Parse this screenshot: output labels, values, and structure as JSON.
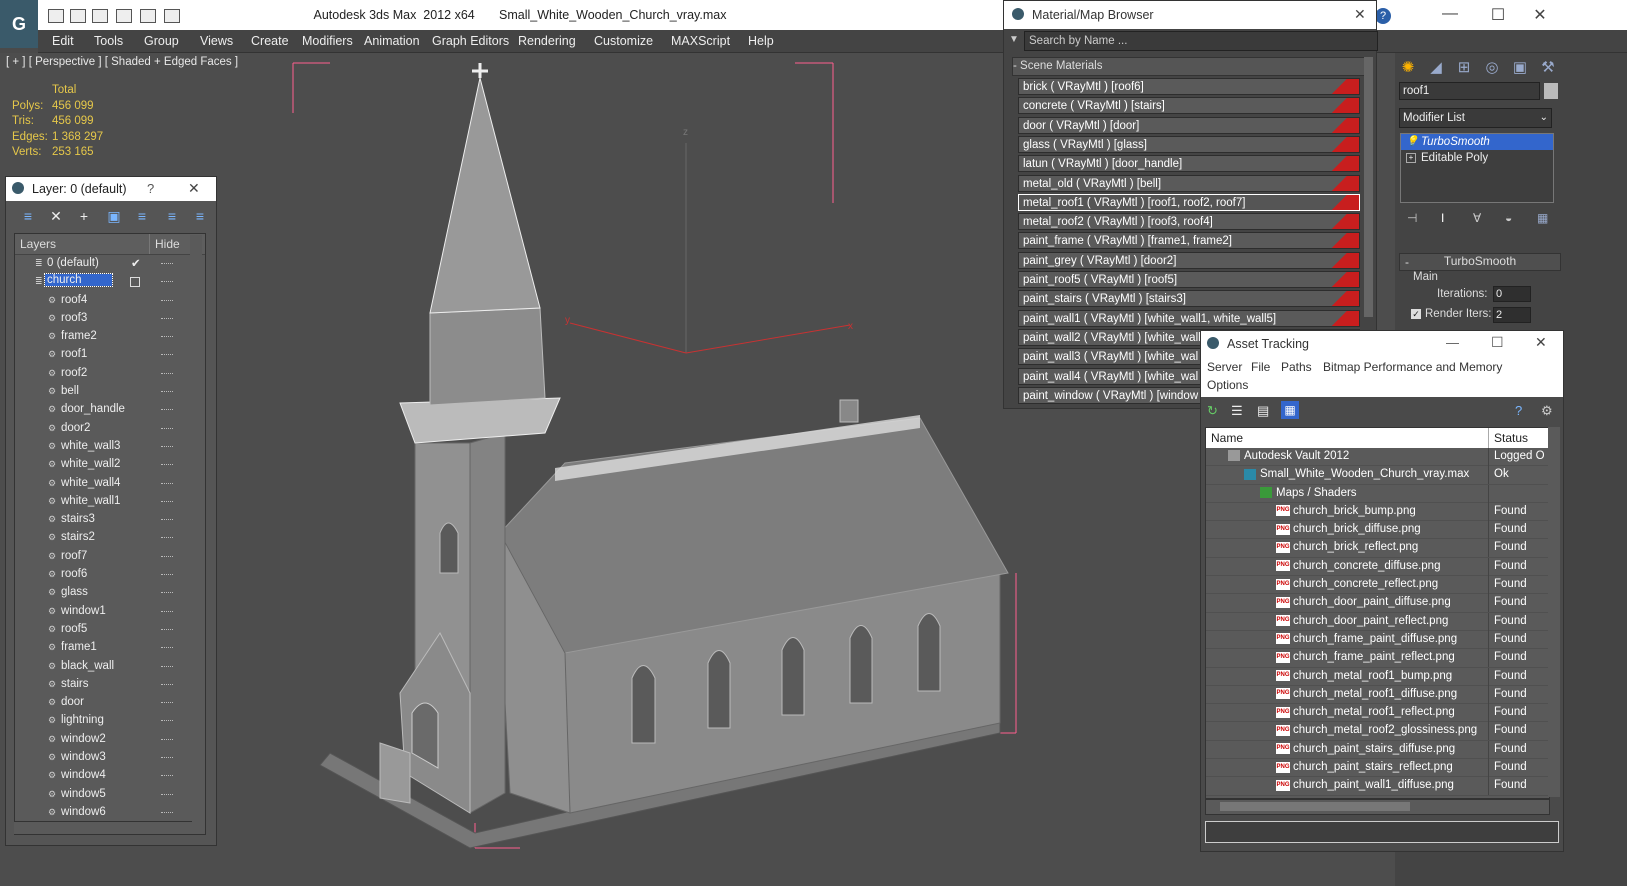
{
  "window": {
    "title": "Autodesk 3ds Max  2012 x64       Small_White_Wooden_Church_vray.max",
    "minimize": "—",
    "maximize": "☐",
    "close": "✕",
    "help": "?"
  },
  "menu": [
    "Edit",
    "Tools",
    "Group",
    "Views",
    "Create",
    "Modifiers",
    "Animation",
    "Graph Editors",
    "Rendering",
    "Customize",
    "MAXScript",
    "Help"
  ],
  "viewport": {
    "label": "[ + ] [ Perspective ] [ Shaded + Edged Faces ]",
    "stats_header": "Total",
    "stats": [
      {
        "k": "Polys:",
        "v": "456 099"
      },
      {
        "k": "Tris:",
        "v": "456 099"
      },
      {
        "k": "Edges:",
        "v": "1 368 297"
      },
      {
        "k": "Verts:",
        "v": "253 165"
      }
    ],
    "axis_x": "x",
    "axis_y": "y",
    "axis_z": "z"
  },
  "layers": {
    "title": "Layer: 0 (default)",
    "help": "?",
    "close": "✕",
    "col_layers": "Layers",
    "col_hide": "Hide",
    "rows": [
      "0 (default)",
      "church",
      "roof4",
      "roof3",
      "frame2",
      "roof1",
      "roof2",
      "bell",
      "door_handle",
      "door2",
      "white_wall3",
      "white_wall2",
      "white_wall4",
      "white_wall1",
      "stairs3",
      "stairs2",
      "roof7",
      "roof6",
      "glass",
      "window1",
      "roof5",
      "frame1",
      "black_wall",
      "stairs",
      "door",
      "lightning",
      "window2",
      "window3",
      "window4",
      "window5",
      "window6"
    ]
  },
  "materials": {
    "title": "Material/Map Browser",
    "close": "✕",
    "search_placeholder": "Search by Name ...",
    "group": "- Scene Materials",
    "rows": [
      "brick  ( VRayMtl ) [roof6]",
      "concrete  ( VRayMtl ) [stairs]",
      "door  ( VRayMtl ) [door]",
      "glass  ( VRayMtl ) [glass]",
      "latun  ( VRayMtl ) [door_handle]",
      "metal_old  ( VRayMtl ) [bell]",
      "metal_roof1  ( VRayMtl ) [roof1, roof2, roof7]",
      "metal_roof2  ( VRayMtl ) [roof3, roof4]",
      "paint_frame  ( VRayMtl ) [frame1, frame2]",
      "paint_grey  ( VRayMtl ) [door2]",
      "paint_roof5  ( VRayMtl ) [roof5]",
      "paint_stairs  ( VRayMtl ) [stairs3]",
      "paint_wall1  ( VRayMtl ) [white_wall1, white_wall5]",
      "paint_wall2  ( VRayMtl ) [white_wall",
      "paint_wall3  ( VRayMtl ) [white_wal",
      "paint_wall4  ( VRayMtl ) [white_wal",
      "paint_window  ( VRayMtl ) [window"
    ]
  },
  "assets": {
    "title": "Asset Tracking",
    "minimize": "—",
    "maximize": "☐",
    "close": "✕",
    "menu": [
      "Server",
      "File",
      "Paths",
      "Bitmap Performance and Memory",
      "Options"
    ],
    "col_name": "Name",
    "col_status": "Status",
    "rows": [
      {
        "name": "Autodesk Vault 2012",
        "status": "Logged O",
        "indent": 1
      },
      {
        "name": "Small_White_Wooden_Church_vray.max",
        "status": "Ok",
        "indent": 2
      },
      {
        "name": "Maps / Shaders",
        "status": "",
        "indent": 3
      },
      {
        "name": "church_brick_bump.png",
        "status": "Found",
        "indent": 4
      },
      {
        "name": "church_brick_diffuse.png",
        "status": "Found",
        "indent": 4
      },
      {
        "name": "church_brick_reflect.png",
        "status": "Found",
        "indent": 4
      },
      {
        "name": "church_concrete_diffuse.png",
        "status": "Found",
        "indent": 4
      },
      {
        "name": "church_concrete_reflect.png",
        "status": "Found",
        "indent": 4
      },
      {
        "name": "church_door_paint_diffuse.png",
        "status": "Found",
        "indent": 4
      },
      {
        "name": "church_door_paint_reflect.png",
        "status": "Found",
        "indent": 4
      },
      {
        "name": "church_frame_paint_diffuse.png",
        "status": "Found",
        "indent": 4
      },
      {
        "name": "church_frame_paint_reflect.png",
        "status": "Found",
        "indent": 4
      },
      {
        "name": "church_metal_roof1_bump.png",
        "status": "Found",
        "indent": 4
      },
      {
        "name": "church_metal_roof1_diffuse.png",
        "status": "Found",
        "indent": 4
      },
      {
        "name": "church_metal_roof1_reflect.png",
        "status": "Found",
        "indent": 4
      },
      {
        "name": "church_metal_roof2_glossiness.png",
        "status": "Found",
        "indent": 4
      },
      {
        "name": "church_paint_stairs_diffuse.png",
        "status": "Found",
        "indent": 4
      },
      {
        "name": "church_paint_stairs_reflect.png",
        "status": "Found",
        "indent": 4
      },
      {
        "name": "church_paint_wall1_diffuse.png",
        "status": "Found",
        "indent": 4
      }
    ]
  },
  "command_panel": {
    "object_name": "roof1",
    "modifier_list": "Modifier List",
    "stack": [
      "TurboSmooth",
      "Editable Poly"
    ],
    "rollout_title": "TurboSmooth",
    "main_label": "Main",
    "iterations_label": "Iterations:",
    "iterations_value": "0",
    "render_iters_label": "Render Iters:",
    "render_iters_value": "2"
  },
  "colors": {
    "accent": "#3399ff",
    "selection_blue": "#3366cc",
    "bbox_pink": "#ff5f8f",
    "stats_yellow": "#e6c84a",
    "swatch_red": "#c81e1e"
  }
}
